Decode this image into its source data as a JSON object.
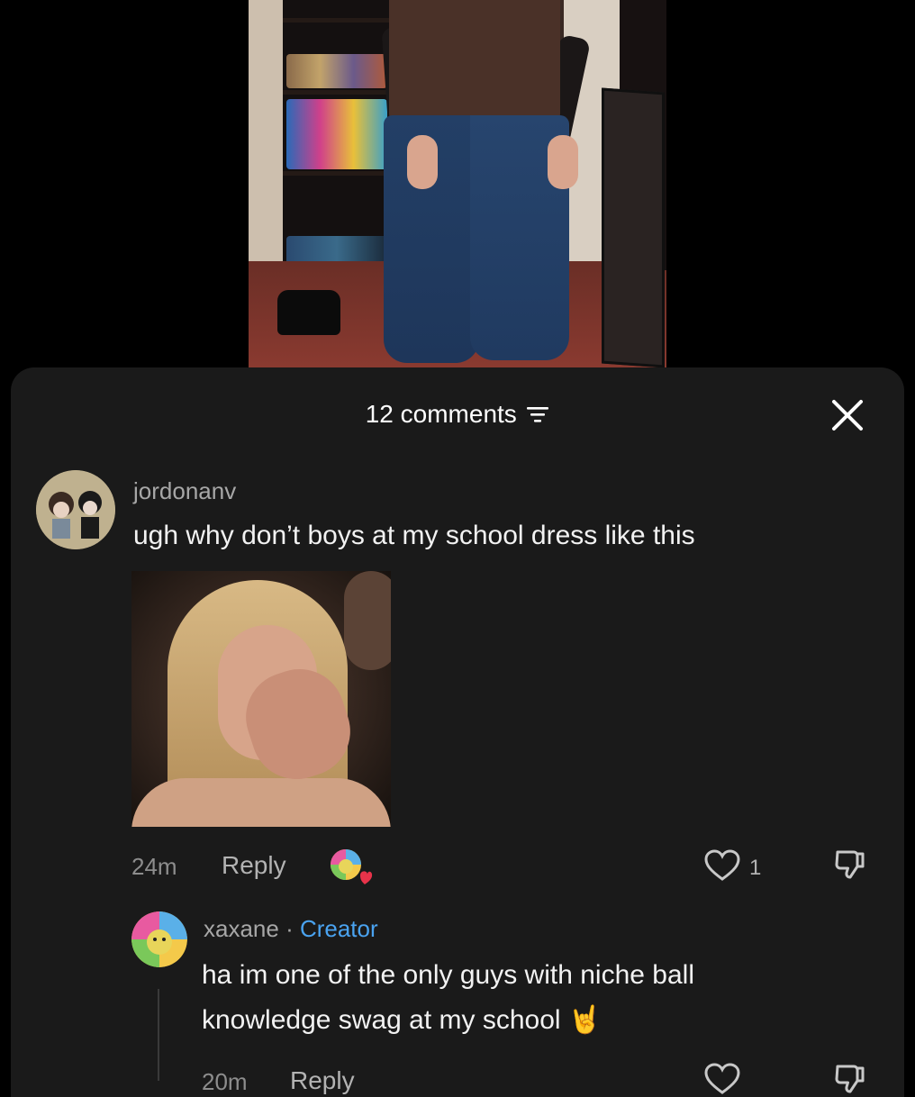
{
  "sheet": {
    "comment_count_label": "12 comments"
  },
  "comments": [
    {
      "username": "jordonanv",
      "text": "ugh why don’t boys at my school dress like this",
      "time": "24m",
      "reply_label": "Reply",
      "like_count": "1"
    },
    {
      "username": "xaxane",
      "separator": " · ",
      "badge": "Creator",
      "text_line1": "ha im one of the only guys with niche ball",
      "text_line2": "knowledge swag at my school",
      "emoji": "🤘",
      "time": "20m",
      "reply_label": "Reply"
    }
  ],
  "icons": {
    "filter": "filter-icon",
    "close": "close-icon",
    "like": "heart-icon",
    "dislike": "thumbs-down-icon"
  },
  "colors": {
    "sheet_bg": "#1a1a1a",
    "creator_badge": "#4aa3f0",
    "heart_reaction": "#e8334a"
  }
}
